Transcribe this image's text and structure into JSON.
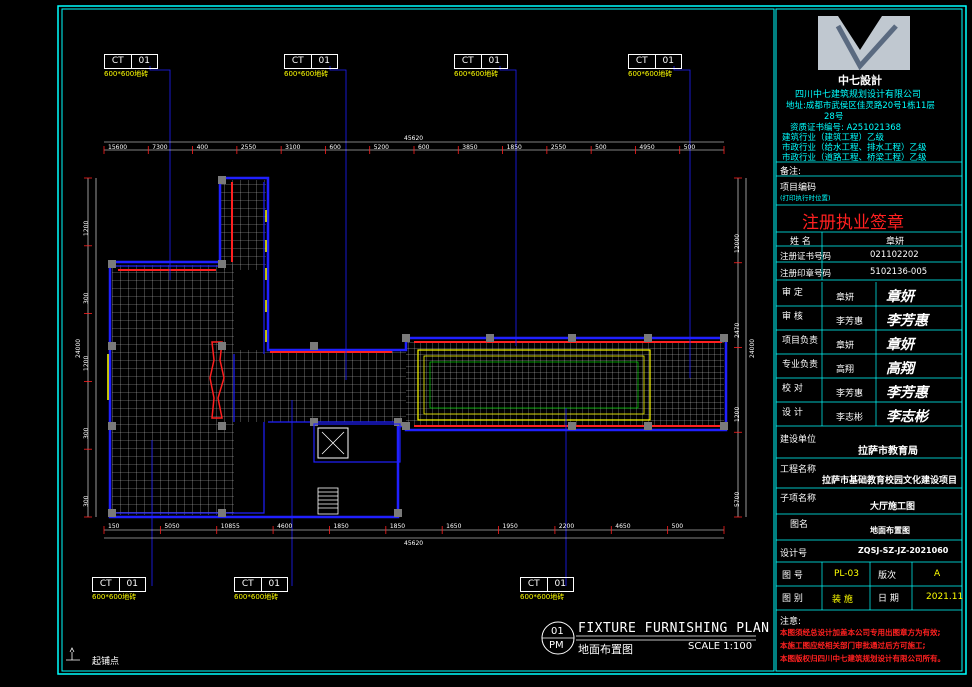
{
  "callouts": {
    "code": "CT",
    "number": "01",
    "note": "600*600地砖"
  },
  "dimensions": {
    "top_overall": "45620",
    "top_segments": [
      "15600",
      "7300",
      "400",
      "2550",
      "3100",
      "600",
      "5200",
      "600",
      "3850",
      "1850",
      "2550",
      "500",
      "4950",
      "500"
    ],
    "bottom_overall": "45620",
    "bottom_segments": [
      "150",
      "5050",
      "10855",
      "4600",
      "1850",
      "1850",
      "1650",
      "1950",
      "2200",
      "4650",
      "500"
    ],
    "left_overall": "24000",
    "left_segments": [
      "1200",
      "300",
      "1200",
      "300",
      "300"
    ],
    "right_overall": "24000",
    "right_segments": [
      "12000",
      "2470",
      "1200",
      "5700"
    ]
  },
  "plan_title": {
    "circle_top": "01",
    "circle_bottom": "PM",
    "title_en": "FIXTURE FURNISHING PLAN",
    "title_cn": "地面布置图",
    "scale": "SCALE 1:100"
  },
  "origin_label": "起铺点",
  "title_block": {
    "company_logo_text": "中七設計",
    "company_name": "四川中七建筑规划设计有限公司",
    "address_1": "地址:成都市武侯区佳灵路20号1栋11层",
    "address_2": "28号",
    "cert": "资质证书编号: A251021368",
    "qual_1": "建筑行业（建筑工程）乙级",
    "qual_2": "市政行业（给水工程、排水工程）乙级",
    "qual_3": "市政行业（道路工程、桥梁工程）乙级",
    "remark_label": "备注:",
    "project_code_label": "项目编码",
    "project_code_sub": "(打印执行时位置)",
    "sign_header": "注册执业签章",
    "name_label": "姓 名",
    "name_value": "章妍",
    "reg_cert_label": "注册证书号码",
    "reg_cert_value": "021102202",
    "reg_seal_label": "注册印章号码",
    "reg_seal_value": "5102136-005",
    "approvals": [
      {
        "label": "审 定",
        "name": "章妍",
        "sig": "章妍"
      },
      {
        "label": "审 核",
        "name": "李芳惠",
        "sig": "李芳惠"
      },
      {
        "label": "项目负责",
        "name": "章妍",
        "sig": "章妍"
      },
      {
        "label": "专业负责",
        "name": "高翔",
        "sig": "高翔"
      },
      {
        "label": "校 对",
        "name": "李芳惠",
        "sig": "李芳惠"
      },
      {
        "label": "设 计",
        "name": "李志彬",
        "sig": "李志彬"
      }
    ],
    "client_label": "建设单位",
    "client_value": "拉萨市教育局",
    "project_label": "工程名称",
    "project_value": "拉萨市基础教育校园文化建设项目",
    "subitem_label": "子项名称",
    "subitem_value": "大厅施工图",
    "drawing_name_label": "图名",
    "drawing_name_value": "地面布置图",
    "drawing_no_label": "设计号",
    "drawing_no_value": "ZQSJ-SZ-JZ-2021060",
    "sheet_label": "图 号",
    "sheet_value": "PL-03",
    "version_label": "版次",
    "version_value": "A",
    "category_label": "图 别",
    "category_value": "装 施",
    "date_label": "日 期",
    "date_value": "2021.11",
    "notes_label": "注意:",
    "notes": [
      "本图须经总设计加盖本公司专用出图章方为有效;",
      "本施工图应经相关部门审批通过后方可施工;",
      "本图版权归四川中七建筑规划设计有限公司所有。"
    ]
  },
  "colors": {
    "frame": "#00ffff",
    "wall": "#2020ff",
    "accent": "#ff2020",
    "grid": "#c8c8c8",
    "text": "#ffffff",
    "highlight": "#ffff00"
  }
}
